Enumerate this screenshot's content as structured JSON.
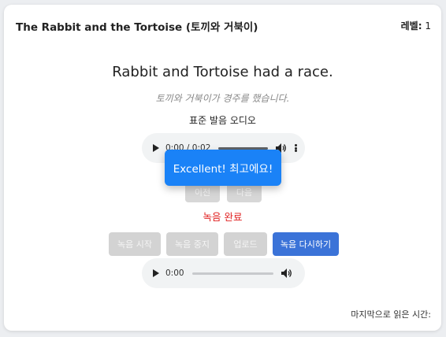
{
  "header": {
    "title": "The Rabbit and the Tortoise (토끼와 거북이)",
    "level_label": "레벨:",
    "level_value": "1"
  },
  "lesson": {
    "sentence": "Rabbit and Tortoise had a race.",
    "translation": "토끼와 거북이가 경주를 했습니다.",
    "audio_label": "표준 발음 오디오"
  },
  "standard_audio": {
    "time": "0:00 / 0:02",
    "progress": 0.0
  },
  "nav": {
    "prev_label": "이전",
    "next_label": "다음"
  },
  "toast": {
    "message": "Excellent! 최고에요!",
    "color": "#1a82f7"
  },
  "status": {
    "text": "녹음 완료",
    "color": "#e02020"
  },
  "recording": {
    "start_label": "녹음 시작",
    "stop_label": "녹음 중지",
    "upload_label": "업로드",
    "again_label": "녹음 다시하기",
    "active_color": "#3b73d8"
  },
  "user_audio": {
    "time": "0:00",
    "progress": 0.0
  },
  "footer": {
    "last_read_label": "마지막으로 읽은 시간:"
  }
}
